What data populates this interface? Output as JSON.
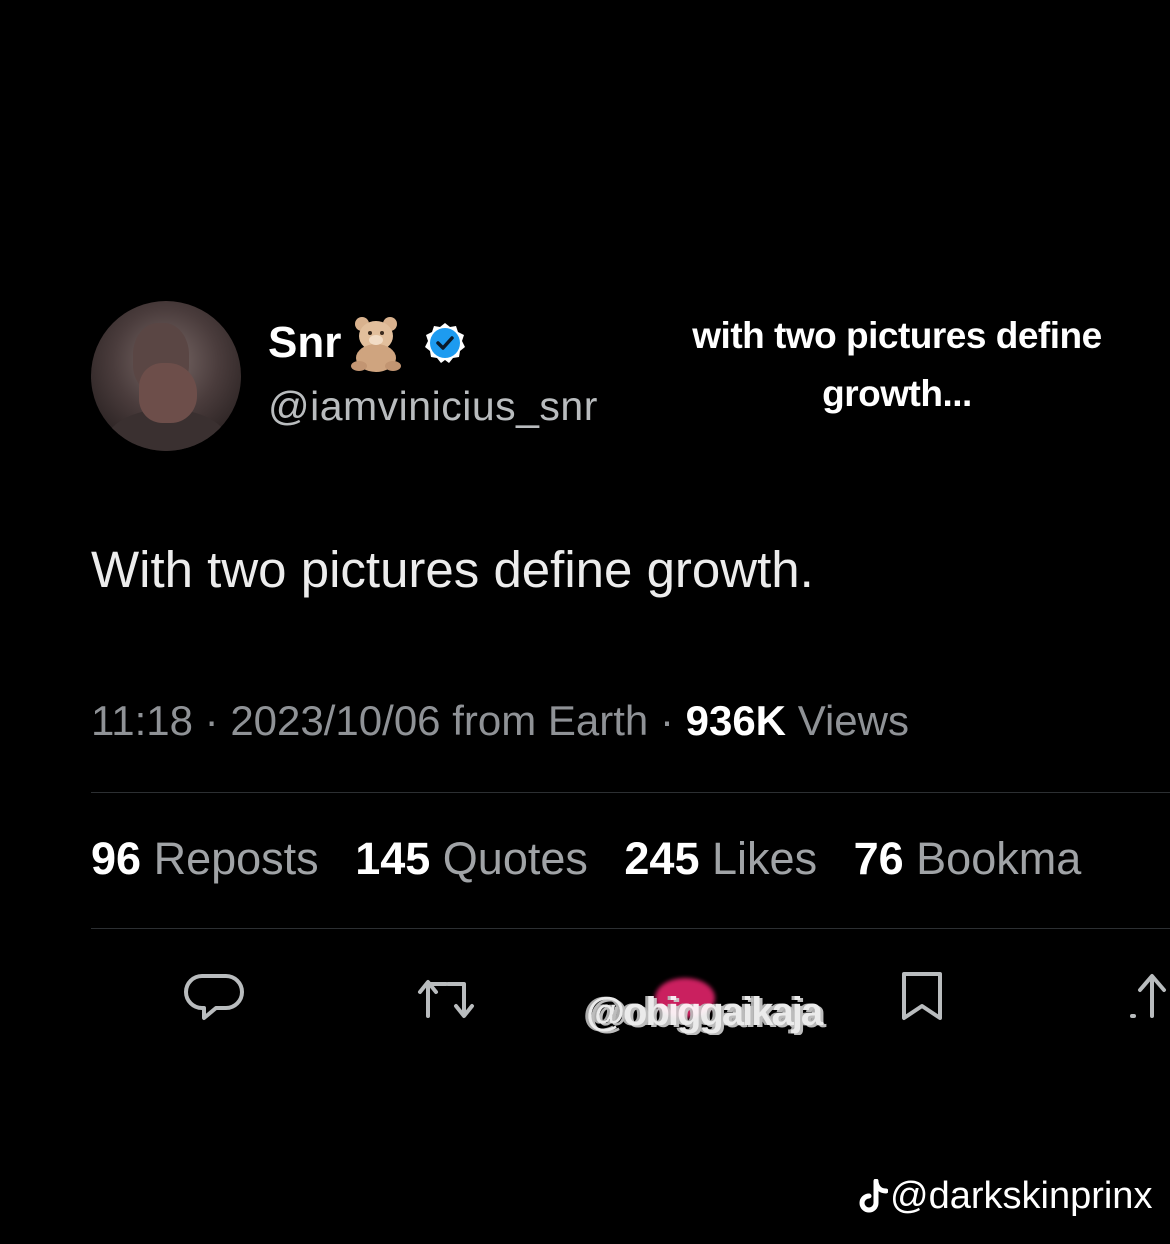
{
  "user": {
    "display_name": "Snr",
    "emoji_icon": "teddy-bear-icon",
    "verified_icon": "verified-badge-icon",
    "handle": "@iamvinicius_snr"
  },
  "caption": {
    "line1": "with two pictures define",
    "line2": "growth..."
  },
  "tweet": {
    "text": "With two pictures define growth.",
    "time": "11:18",
    "date": "2023/10/06",
    "source": "from Earth",
    "views_count": "936K",
    "views_label": "Views"
  },
  "stats": {
    "reposts_count": "96",
    "reposts_label": "Reposts",
    "quotes_count": "145",
    "quotes_label": "Quotes",
    "likes_count": "245",
    "likes_label": "Likes",
    "bookmarks_count": "76",
    "bookmarks_label": "Bookma"
  },
  "overlay": {
    "garbled_watermark": "@obiggaikaja"
  },
  "watermark": {
    "icon": "tiktok-icon",
    "handle": "@darkskinprinx"
  },
  "colors": {
    "background": "#000000",
    "verified": "#1d9bf0",
    "like": "#e0246a"
  }
}
